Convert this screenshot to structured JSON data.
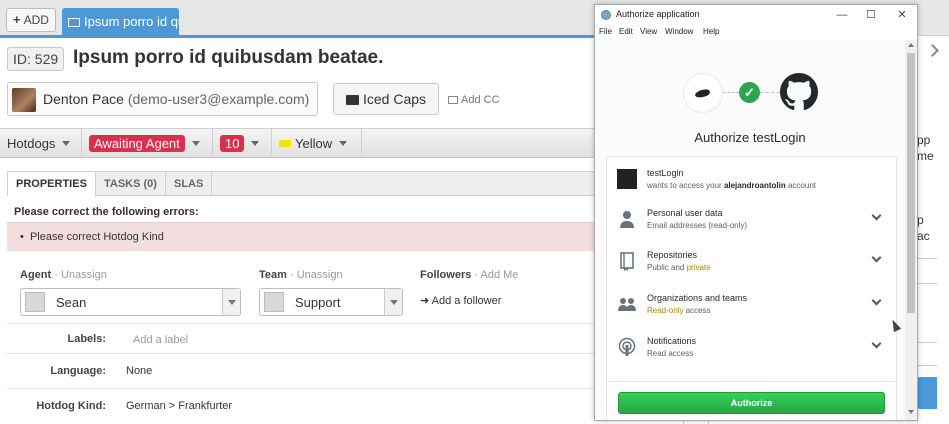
{
  "app": {
    "add_label": "ADD",
    "ticket_tab_label": "Ipsum porro id qu",
    "ticket_id": "ID: 529",
    "ticket_title": "Ipsum porro id quibusdam beatae.",
    "requester_name": "Denton Pace",
    "requester_email": "(demo-user3@example.com)",
    "organization": "Iced Caps",
    "add_cc_label": "Add CC",
    "properties": {
      "category": "Hotdogs",
      "status": "Awaiting Agent",
      "priority": "10",
      "label_color": "Yellow"
    },
    "subtabs": [
      "PROPERTIES",
      "TASKS (0)",
      "SLAS"
    ],
    "error_title": "Please correct the following errors:",
    "error_message": "Please correct Hotdog Kind",
    "agent": {
      "label": "Agent",
      "action": "Unassign",
      "value": "Sean"
    },
    "team": {
      "label": "Team",
      "action": "Unassign",
      "value": "Support"
    },
    "followers": {
      "label": "Followers",
      "action": "Add Me",
      "add_label": "Add a follower"
    },
    "fields": {
      "labels_label": "Labels:",
      "labels_placeholder": "Add a label",
      "language_label": "Language:",
      "language_value": "None",
      "hotdog_kind_label": "Hotdog Kind:",
      "hotdog_kind_value": "German > Frankfurter"
    },
    "right_edge_text": [
      "pp",
      "me",
      "p",
      "ac"
    ],
    "separator": " · "
  },
  "auth_window": {
    "title": "Authorize application",
    "controls": [
      "—",
      "☐",
      "✕"
    ],
    "menu": [
      "File",
      "Edit",
      "View",
      "Window",
      "Help"
    ],
    "heading": "Authorize testLogin",
    "app_name": "testLogin",
    "app_request_prefix": "wants to access your",
    "account": "alejandroantolin",
    "app_request_suffix": "account",
    "permissions": [
      {
        "title": "Personal user data",
        "desc": "Email addresses (read-only)",
        "desc_highlight": "",
        "icon": "person-icon"
      },
      {
        "title": "Repositories",
        "desc": "Public and",
        "desc_highlight": "private",
        "icon": "repo-icon"
      },
      {
        "title": "Organizations and teams",
        "desc": "access",
        "desc_highlight": "Read-only",
        "icon": "organization-icon"
      },
      {
        "title": "Notifications",
        "desc": "Read access",
        "desc_highlight": "",
        "icon": "broadcast-icon"
      }
    ],
    "authorize_label": "Authorize"
  },
  "colors": {
    "tab_blue": "#4c99d6",
    "status_red": "#d9304b",
    "yellow": "#f2e600",
    "authorize_green": "#2ea44f",
    "error_bg": "#f2dede"
  }
}
